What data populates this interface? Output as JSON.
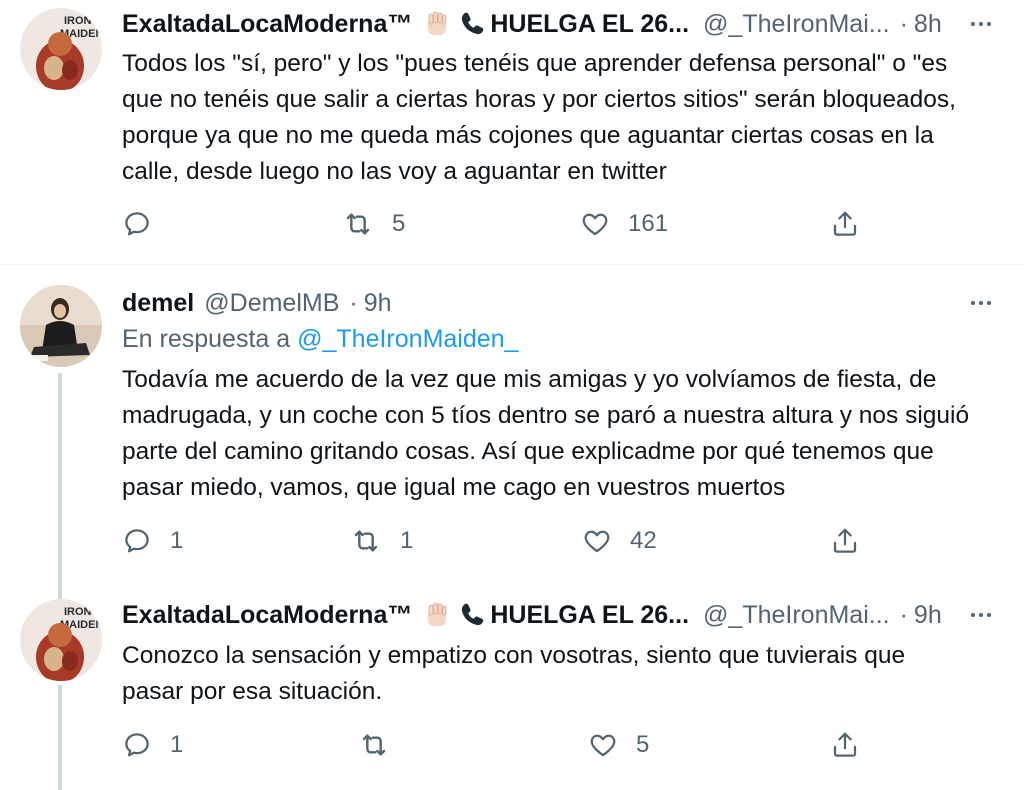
{
  "tweets": [
    {
      "name": "ExaltadaLocaModerna™",
      "emoji_hand": "raised-fist-emoji",
      "emoji_phone": "telephone-emoji",
      "tagline": "HUELGA EL 26...",
      "handle": "@_TheIronMai...",
      "dot": "·",
      "time": "8h",
      "avatar_text": "IRON MAIDEN",
      "text_lines": [
        "Todos los \"sí, pero\" y los \"pues tenéis que aprender defensa personal\" o  \"es",
        "que no tenéis que salir a ciertas horas y por ciertos sitios\" serán bloqueados,",
        "porque ya que no me queda más cojones que aguantar ciertas cosas en la",
        "calle, desde luego no las voy a aguantar en twitter"
      ],
      "replies": "",
      "retweets": "5",
      "likes": "161"
    },
    {
      "name": "demel",
      "handle": "@DemelMB",
      "dot": "·",
      "time": "9h",
      "reply_prefix": "En respuesta a",
      "reply_handle": "@_TheIronMaiden_",
      "text_lines": [
        "Todavía me acuerdo de la vez que mis amigas y yo volvíamos de fiesta, de",
        "madrugada, y un coche con 5 tíos dentro se paró a nuestra altura y nos siguió",
        "parte del camino gritando cosas. Así que explicadme por qué tenemos que",
        "pasar miedo, vamos, que igual me cago en vuestros muertos"
      ],
      "replies": "1",
      "retweets": "1",
      "likes": "42"
    },
    {
      "name": "ExaltadaLocaModerna™",
      "emoji_hand": "raised-fist-emoji",
      "emoji_phone": "telephone-emoji",
      "tagline": "HUELGA EL 26...",
      "handle": "@_TheIronMai...",
      "dot": "·",
      "time": "9h",
      "avatar_text": "IRON MAIDEN",
      "text_lines": [
        "Conozco la sensación y empatizo con vosotras, siento que tuvierais que",
        "pasar por esa situación."
      ],
      "replies": "1",
      "retweets": "",
      "likes": "5"
    }
  ],
  "icons": {
    "reply": "reply-icon",
    "retweet": "retweet-icon",
    "like": "heart-icon",
    "share": "share-icon",
    "more": "more-icon"
  },
  "colors": {
    "text": "#0f1419",
    "secondary": "#536471",
    "link": "#1d9bf0",
    "thread_line": "#cfd9de",
    "divider": "#eff3f4"
  }
}
